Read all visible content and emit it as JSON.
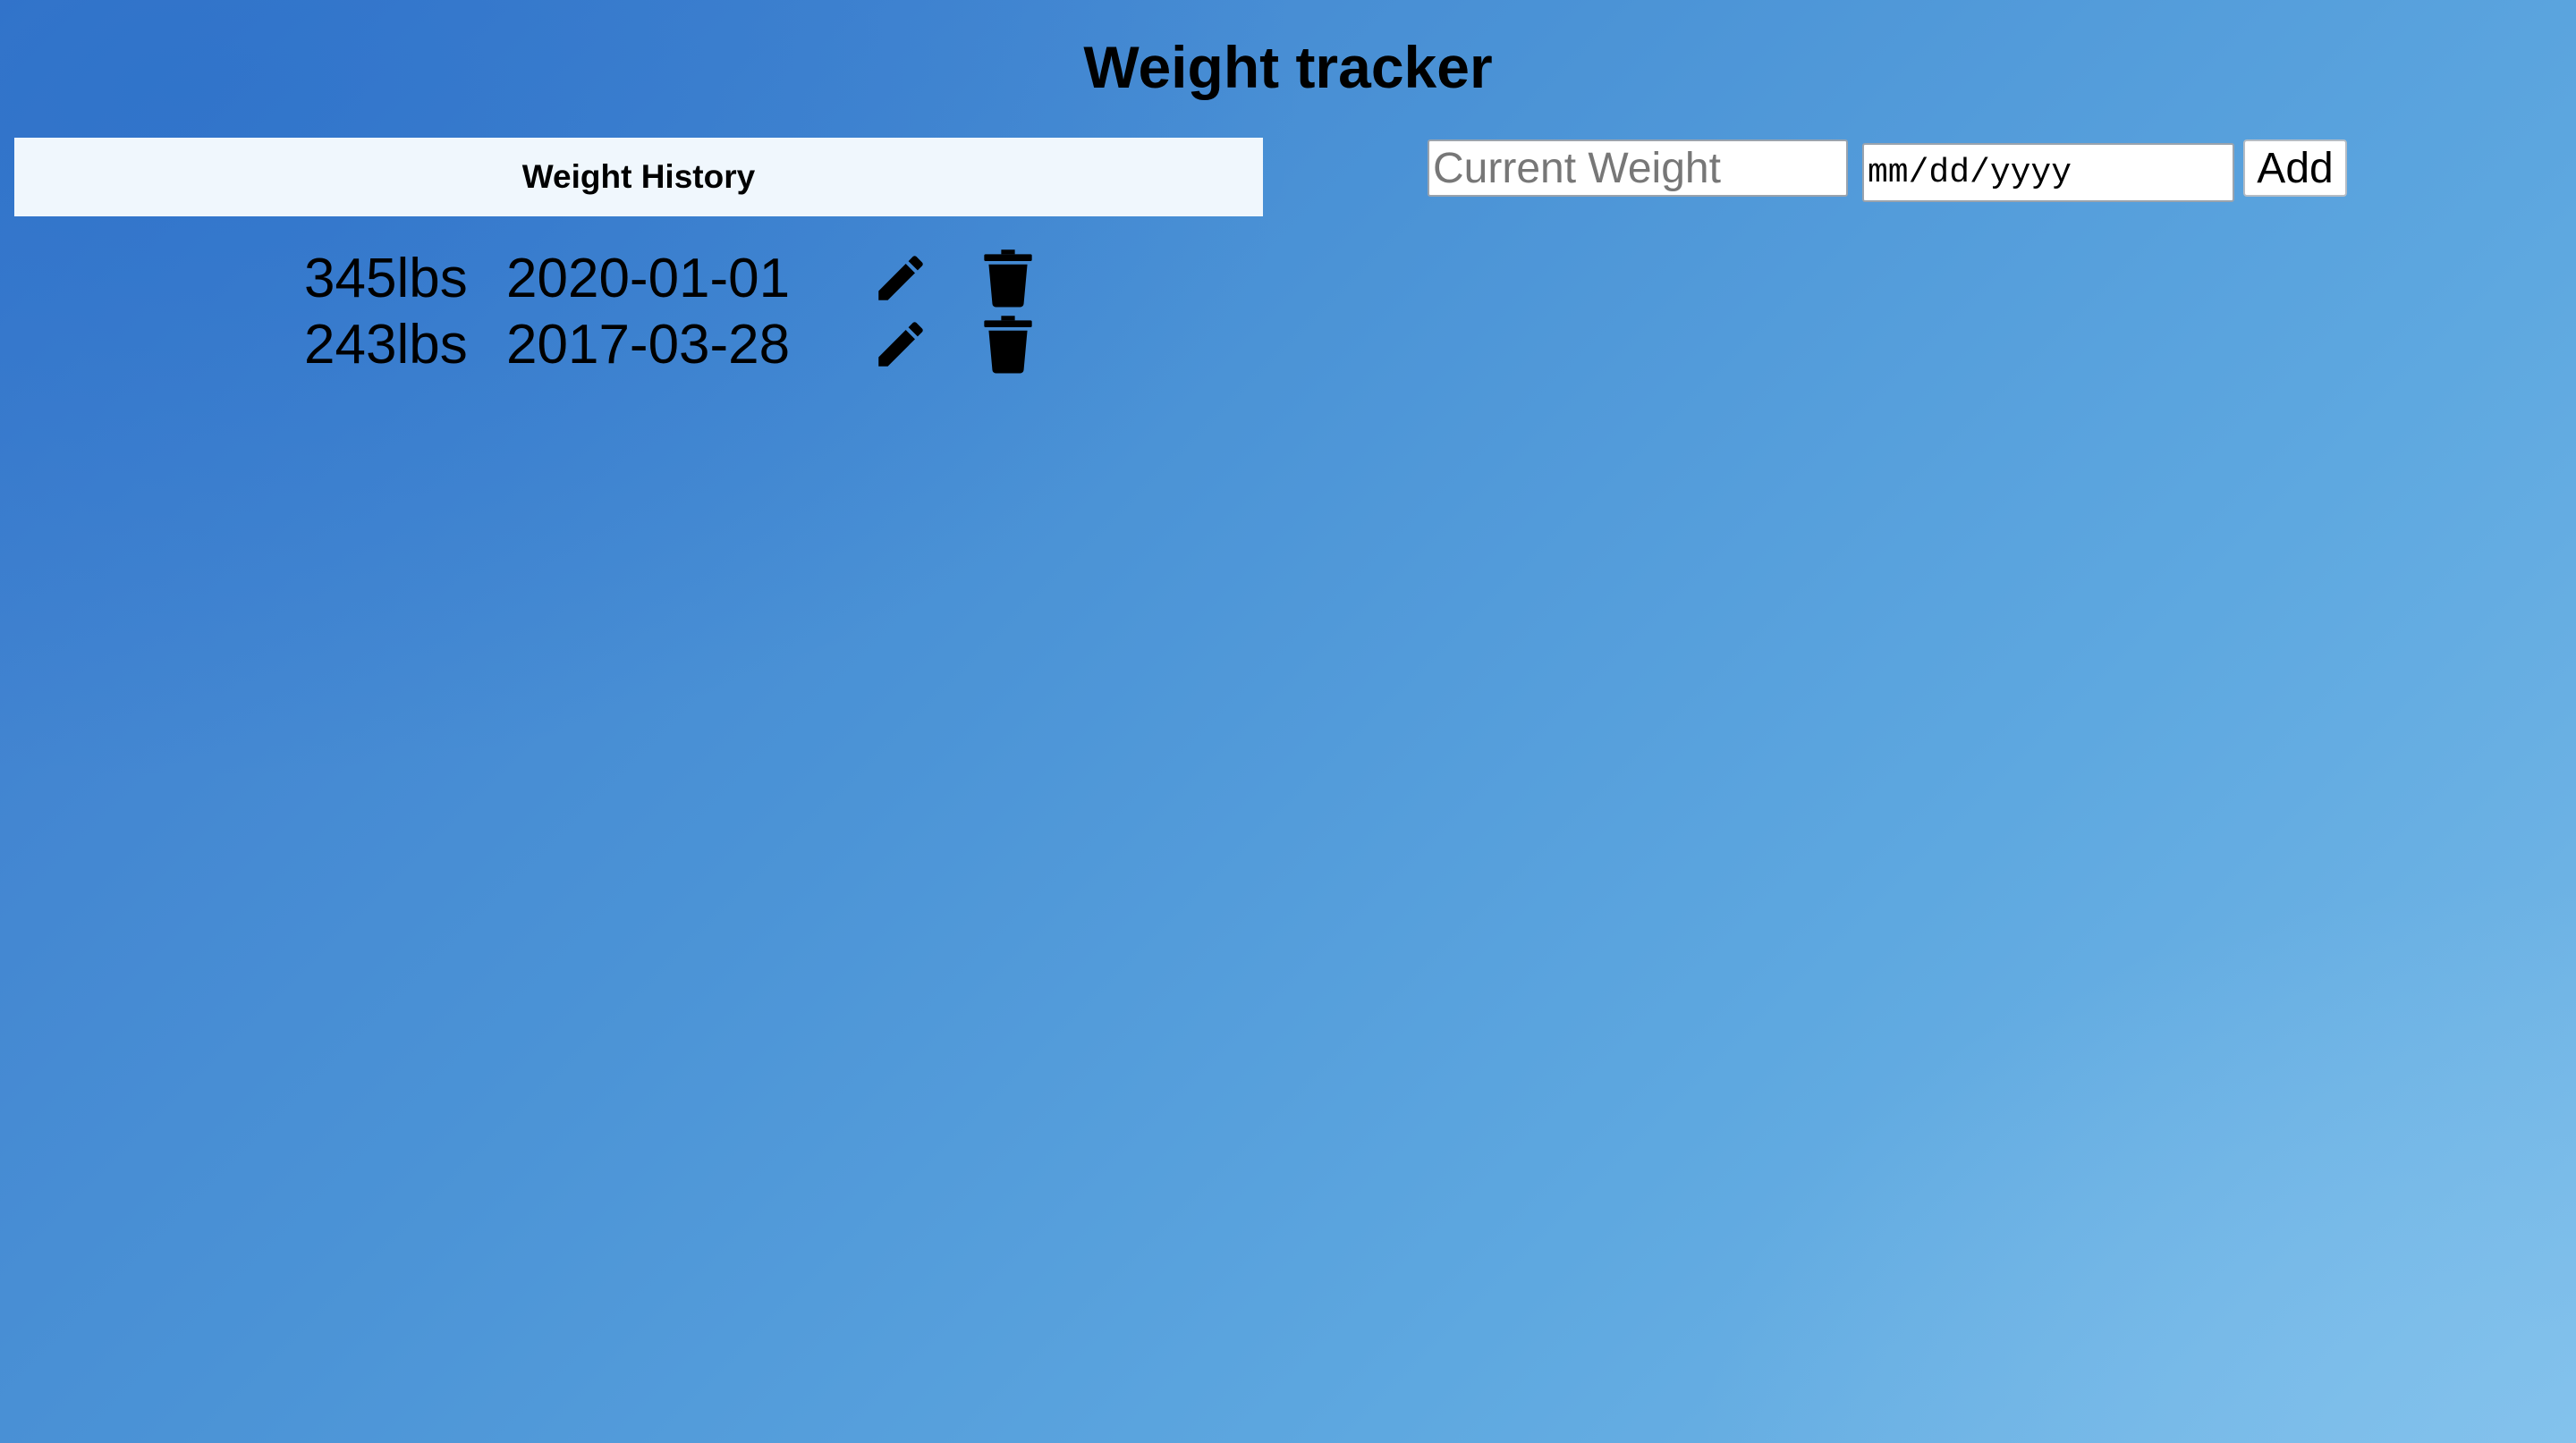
{
  "page": {
    "title": "Weight tracker"
  },
  "history": {
    "header": "Weight History",
    "entries": [
      {
        "weight": "345lbs",
        "date": "2020-01-01"
      },
      {
        "weight": "243lbs",
        "date": "2017-03-28"
      }
    ]
  },
  "form": {
    "weight_placeholder": "Current Weight",
    "date_placeholder": "mm/dd/yyyy",
    "add_label": "Add"
  },
  "icons": {
    "edit": "pencil-icon",
    "delete": "trash-icon"
  },
  "colors": {
    "background_start": "#3a78cc",
    "background_end": "#79bbe8",
    "header_bg": "#f0f7fd"
  }
}
